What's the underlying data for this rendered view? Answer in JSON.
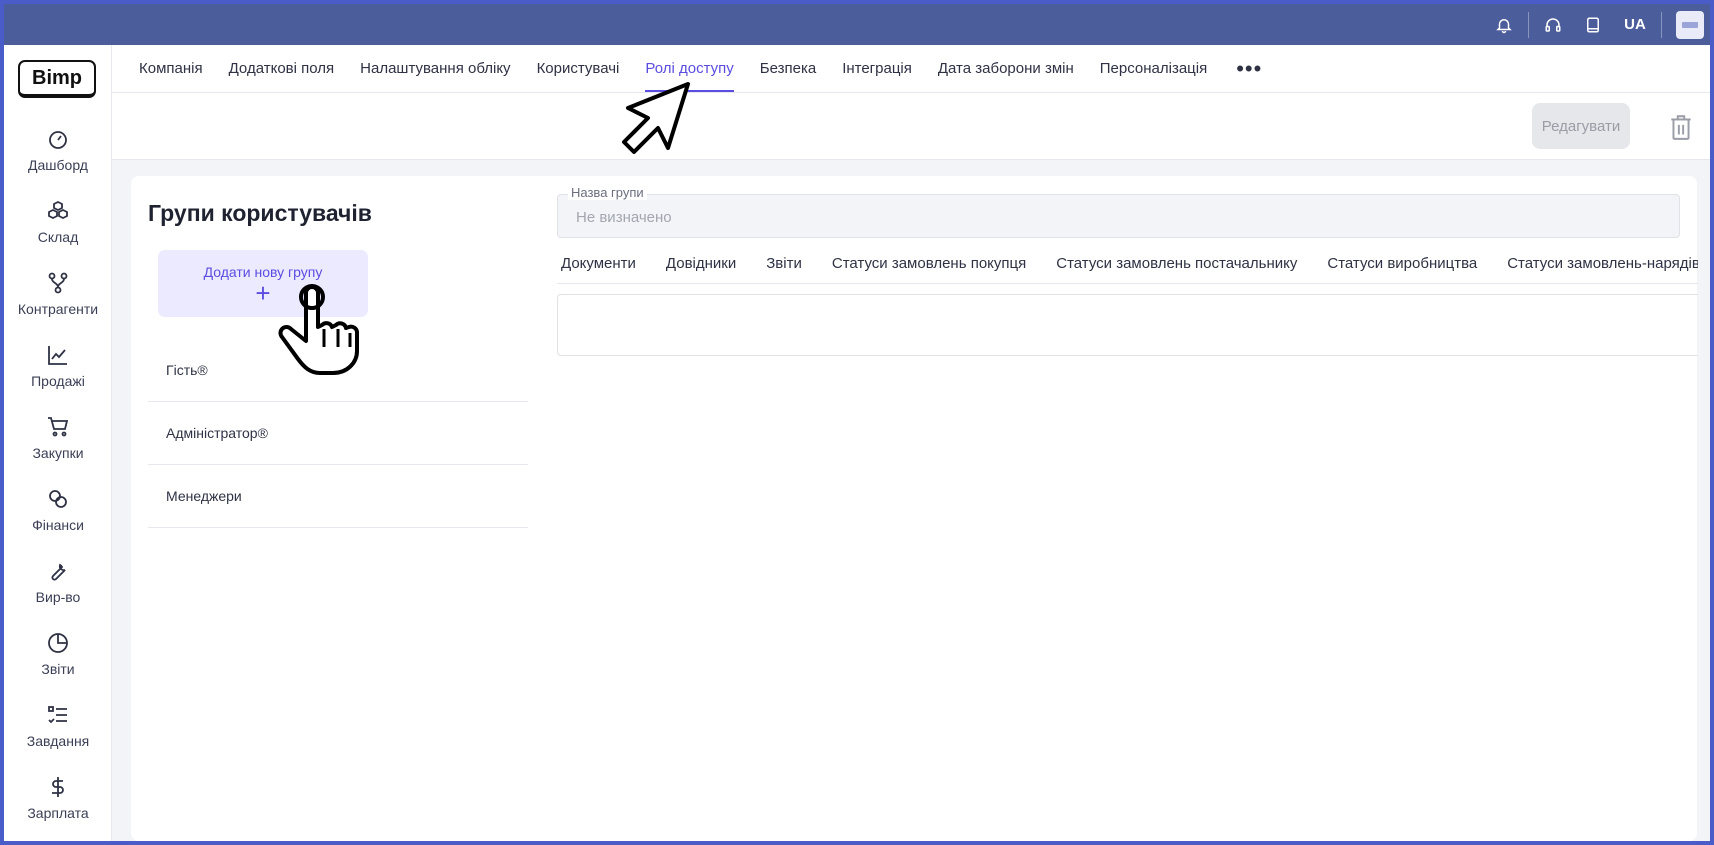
{
  "topbar": {
    "language": "UA",
    "icons": [
      "bell-icon",
      "headset-icon",
      "book-icon"
    ]
  },
  "sidebar": {
    "logo": "Bimp",
    "items": [
      {
        "label": "Дашборд",
        "icon": "speedometer-icon"
      },
      {
        "label": "Склад",
        "icon": "boxes-icon"
      },
      {
        "label": "Контрагенти",
        "icon": "network-icon"
      },
      {
        "label": "Продажі",
        "icon": "chart-line-icon"
      },
      {
        "label": "Закупки",
        "icon": "cart-icon"
      },
      {
        "label": "Фінанси",
        "icon": "coins-icon"
      },
      {
        "label": "Вир-во",
        "icon": "wrench-icon"
      },
      {
        "label": "Звіти",
        "icon": "pie-chart-icon"
      },
      {
        "label": "Завдання",
        "icon": "checklist-icon"
      },
      {
        "label": "Зарплата",
        "icon": "dollar-icon"
      }
    ]
  },
  "tabs": [
    {
      "label": "Компанія"
    },
    {
      "label": "Додаткові поля"
    },
    {
      "label": "Налаштування обліку"
    },
    {
      "label": "Користувачі"
    },
    {
      "label": "Ролі доступу",
      "active": true
    },
    {
      "label": "Безпека"
    },
    {
      "label": "Інтеграція"
    },
    {
      "label": "Дата заборони змін"
    },
    {
      "label": "Персоналізація"
    }
  ],
  "tabs_more": "•••",
  "toolbar": {
    "edit_label": "Редагувати"
  },
  "groups": {
    "title": "Групи користувачів",
    "add_label": "Додати нову групу",
    "add_plus": "+",
    "items": [
      "Гість®",
      "Адміністратор®",
      "Менеджери"
    ]
  },
  "group_name": {
    "label": "Назва групи",
    "value": "Не визначено"
  },
  "permission_tabs": [
    "Документи",
    "Довідники",
    "Звіти",
    "Статуси замовлень покупця",
    "Статуси замовлень постачальнику",
    "Статуси виробництва",
    "Статуси замовлень-нарядів"
  ],
  "colors": {
    "accent": "#5b4de0",
    "topbar": "#4c5d9c",
    "frame": "#4a5cc8"
  }
}
